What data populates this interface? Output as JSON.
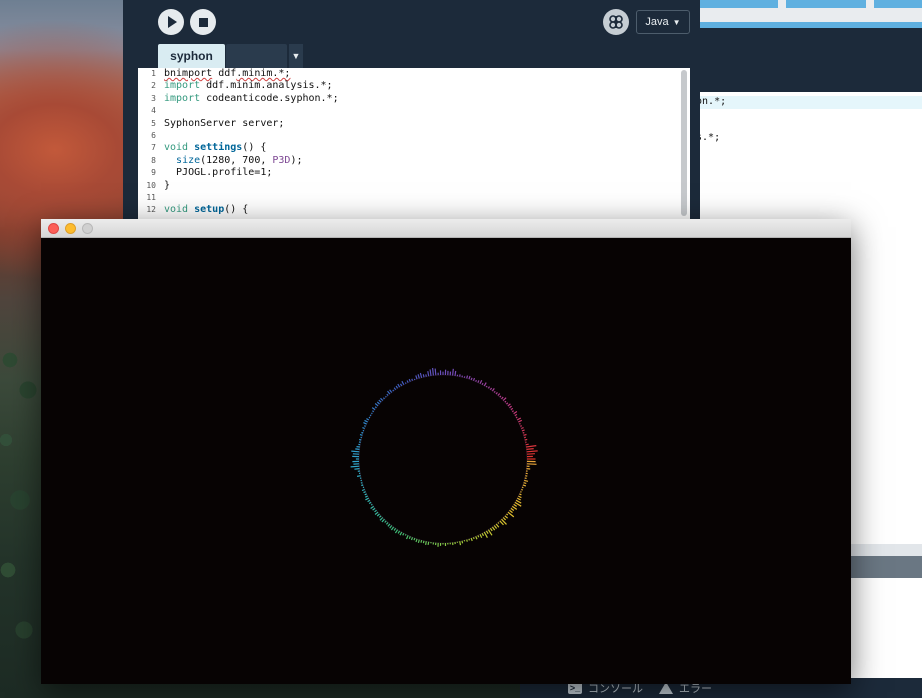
{
  "editor": {
    "run_icon": "play-icon",
    "stop_icon": "stop-icon",
    "debug_icon": "butterfly-icon",
    "mode_label": "Java",
    "tab_label": "syphon",
    "code_lines": [
      {
        "n": "1",
        "html": "<span class=\"err\">bnimport</span> ddf<span class=\"err\">.minim.*;</span>"
      },
      {
        "n": "2",
        "html": "<span class=\"kw\">import</span> ddf.minim.analysis.*;"
      },
      {
        "n": "3",
        "html": "<span class=\"kw\">import</span> codeanticode.syphon.*;"
      },
      {
        "n": "4",
        "html": ""
      },
      {
        "n": "5",
        "html": "SyphonServer server;"
      },
      {
        "n": "6",
        "html": ""
      },
      {
        "n": "7",
        "html": "<span class=\"kw\">void</span> <span class=\"fn\">settings</span>() {"
      },
      {
        "n": "8",
        "html": "  <span class=\"call\">size</span>(1280, 700, <span class=\"lit\">P3D</span>);"
      },
      {
        "n": "9",
        "html": "  PJOGL.profile=1;"
      },
      {
        "n": "10",
        "html": "}"
      },
      {
        "n": "11",
        "html": ""
      },
      {
        "n": "12",
        "html": "<span class=\"kw\">void</span> <span class=\"fn\">setup</span>() {"
      }
    ]
  },
  "background_editor": {
    "code_fragment_1": "hon.*;",
    "code_fragment_2": "is.*;",
    "console_label": "コンソール",
    "errors_label": "エラー",
    "console_icon": "terminal-icon",
    "errors_icon": "warning-icon"
  },
  "sketch_window": {
    "close_icon": "close-light-icon",
    "minimize_icon": "minimize-light-icon",
    "maximize_icon": "maximize-light-icon",
    "visualization": {
      "type": "circular-spectrum",
      "background": "#070303",
      "colors": [
        "#e0342a",
        "#c23a8a",
        "#7a4ab8",
        "#3f5fc4",
        "#2f8fd0",
        "#33b6c6",
        "#3fbf73",
        "#9ccc3a",
        "#e2c12e",
        "#e8a23a"
      ]
    }
  }
}
